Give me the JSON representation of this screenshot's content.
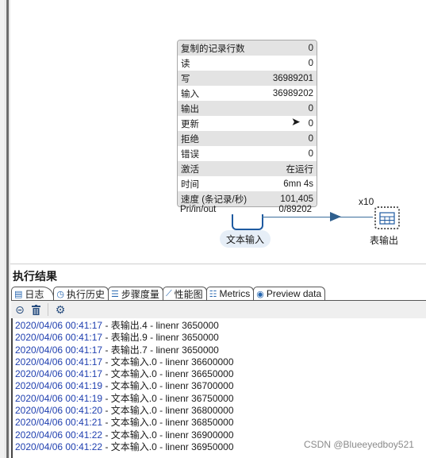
{
  "step_stats": {
    "rows": [
      {
        "label": "复制的记录行数",
        "value": "0"
      },
      {
        "label": "读",
        "value": "0"
      },
      {
        "label": "写",
        "value": "36989201"
      },
      {
        "label": "输入",
        "value": "36989202"
      },
      {
        "label": "输出",
        "value": "0"
      },
      {
        "label": "更新",
        "value": "0"
      },
      {
        "label": "拒绝",
        "value": "0"
      },
      {
        "label": "错误",
        "value": "0"
      },
      {
        "label": "激活",
        "value": "在运行"
      },
      {
        "label": "时间",
        "value": "6mn 4s"
      },
      {
        "label": "速度 (条记录/秒)",
        "value": "101,405"
      }
    ],
    "pri_label": "Pri/in/out",
    "pri_value": "0/89202"
  },
  "canvas": {
    "source_step": {
      "label": "文本输入",
      "icon": "text-file-input-icon"
    },
    "target_step": {
      "label": "表输出",
      "icon": "table-output-icon",
      "copies": "x10"
    },
    "hop_color": "#2f5f8e"
  },
  "results": {
    "title": "执行结果",
    "tabs": [
      {
        "label": "日志",
        "icon": "log-icon",
        "active": true
      },
      {
        "label": "执行历史",
        "icon": "history-icon",
        "active": false
      },
      {
        "label": "步骤度量",
        "icon": "step-metrics-icon",
        "active": false
      },
      {
        "label": "性能图",
        "icon": "performance-chart-icon",
        "active": false
      },
      {
        "label": "Metrics",
        "icon": "metrics-icon",
        "active": false
      },
      {
        "label": "Preview data",
        "icon": "preview-eye-icon",
        "active": false
      }
    ],
    "toolbar": {
      "clear_icon": "⊝",
      "delete_icon": "🗑",
      "settings_icon": "⚙"
    },
    "log": [
      {
        "time": "2020/04/06 00:41:17",
        "msg": " - 表输出.4 - linenr 3650000"
      },
      {
        "time": "2020/04/06 00:41:17",
        "msg": " - 表输出.9 - linenr 3650000"
      },
      {
        "time": "2020/04/06 00:41:17",
        "msg": " - 表输出.7 - linenr 3650000"
      },
      {
        "time": "2020/04/06 00:41:17",
        "msg": " - 文本输入.0 - linenr 36600000"
      },
      {
        "time": "2020/04/06 00:41:17",
        "msg": " - 文本输入.0 - linenr 36650000"
      },
      {
        "time": "2020/04/06 00:41:19",
        "msg": " - 文本输入.0 - linenr 36700000"
      },
      {
        "time": "2020/04/06 00:41:19",
        "msg": " - 文本输入.0 - linenr 36750000"
      },
      {
        "time": "2020/04/06 00:41:20",
        "msg": " - 文本输入.0 - linenr 36800000"
      },
      {
        "time": "2020/04/06 00:41:21",
        "msg": " - 文本输入.0 - linenr 36850000"
      },
      {
        "time": "2020/04/06 00:41:22",
        "msg": " - 文本输入.0 - linenr 36900000"
      },
      {
        "time": "2020/04/06 00:41:22",
        "msg": " - 文本输入.0 - linenr 36950000"
      }
    ]
  },
  "watermark": "CSDN @Blueeyedboy521"
}
